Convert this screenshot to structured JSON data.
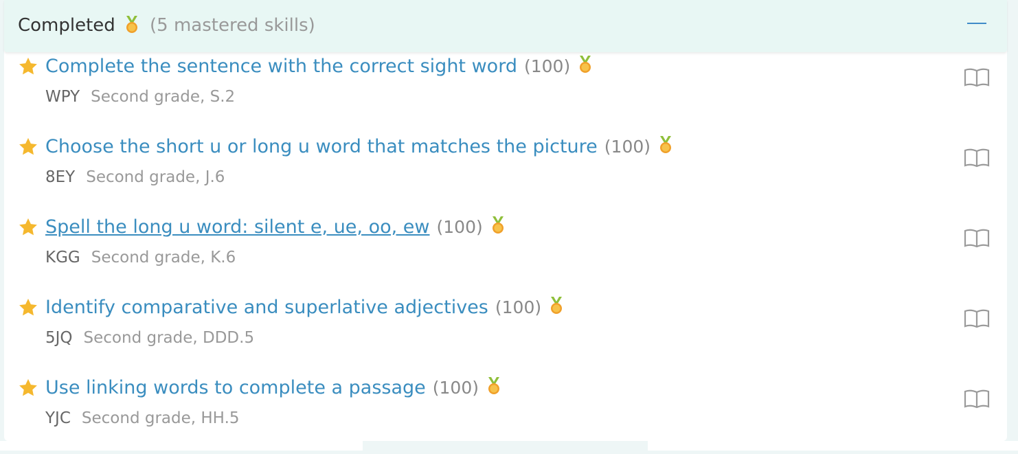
{
  "header": {
    "title": "Completed",
    "count_text": "(5 mastered skills)"
  },
  "colors": {
    "link": "#3a8dbf",
    "star": "#f5b82e",
    "medal_gold": "#f0a02a",
    "medal_ribbon": "#8fbf3a",
    "header_bg": "#e8f7f4"
  },
  "skills": [
    {
      "title": "Complete the sentence with the correct sight word",
      "score": "(100)",
      "code": "WPY",
      "grade": "Second grade, S.2"
    },
    {
      "title": "Choose the short u or long u word that matches the picture",
      "score": "(100)",
      "code": "8EY",
      "grade": "Second grade, J.6"
    },
    {
      "title": "Spell the long u word: silent e, ue, oo, ew",
      "score": "(100)",
      "code": "KGG",
      "grade": "Second grade, K.6"
    },
    {
      "title": "Identify comparative and superlative adjectives",
      "score": "(100)",
      "code": "5JQ",
      "grade": "Second grade, DDD.5"
    },
    {
      "title": "Use linking words to complete a passage",
      "score": "(100)",
      "code": "YJC",
      "grade": "Second grade, HH.5"
    }
  ]
}
